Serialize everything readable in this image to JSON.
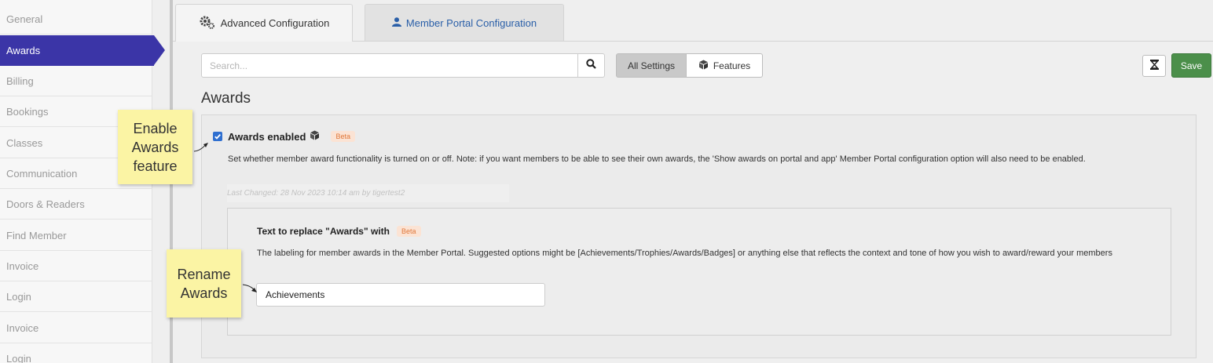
{
  "sidebar": {
    "items": [
      {
        "label": "General"
      },
      {
        "label": "Awards",
        "active": true
      },
      {
        "label": "Billing"
      },
      {
        "label": "Bookings"
      },
      {
        "label": "Classes"
      },
      {
        "label": "Communication"
      },
      {
        "label": "Doors & Readers"
      },
      {
        "label": "Find Member"
      },
      {
        "label": "Invoice"
      },
      {
        "label": "Login"
      },
      {
        "label": "Invoice"
      },
      {
        "label": "Login"
      }
    ]
  },
  "tabs": {
    "advanced": {
      "label": "Advanced Configuration",
      "icon": "gears-icon"
    },
    "portal": {
      "label": "Member Portal Configuration",
      "icon": "user-icon"
    }
  },
  "toolbar": {
    "search_placeholder": "Search...",
    "all_settings_label": "All Settings",
    "features_label": "Features",
    "save_label": "Save"
  },
  "section": {
    "title": "Awards"
  },
  "awards_enabled": {
    "checked": true,
    "title": "Awards enabled",
    "badge": "Beta",
    "description": "Set whether member award functionality is turned on or off. Note: if you want members to be able to see their own awards, the 'Show awards on portal and app' Member Portal configuration option will also need to be enabled.",
    "last_changed": "Last Changed: 28 Nov 2023 10:14 am by tigertest2"
  },
  "rename_awards": {
    "title": "Text to replace \"Awards\" with",
    "badge": "Beta",
    "description": "The labeling for member awards in the Member Portal. Suggested options might be [Achievements/Trophies/Awards/Badges] or anything else that reflects the context and tone of how you wish to award/reward your members",
    "value": "Achievements"
  },
  "annotations": {
    "enable_note": "Enable Awards feature",
    "rename_note": "Rename Awards"
  },
  "colors": {
    "active_sidebar": "#3b35a7",
    "save_button": "#4b8f4a",
    "checkbox": "#2f6fd0",
    "beta_text": "#e0783a",
    "note_bg": "#fbf4a4"
  }
}
